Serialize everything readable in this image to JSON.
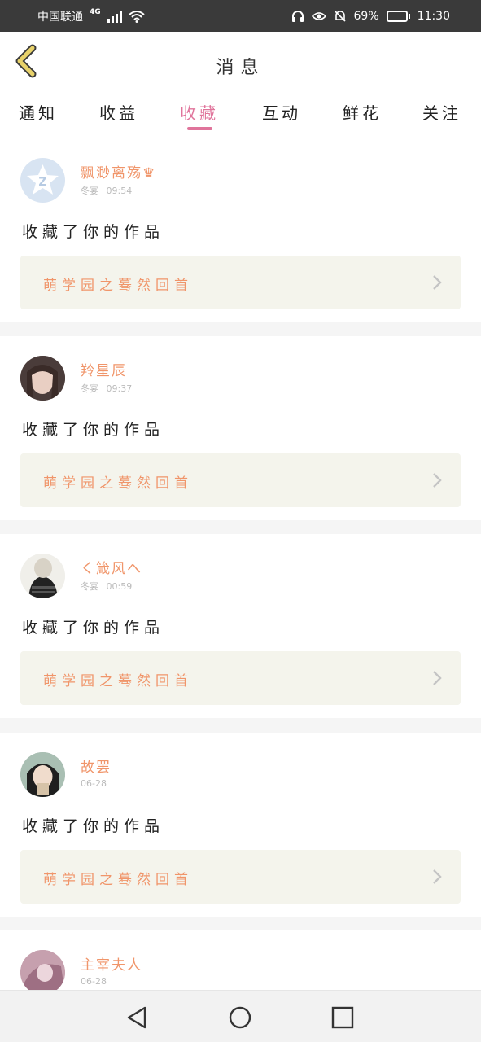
{
  "status_bar": {
    "carrier": "中国联通",
    "network": "4G",
    "battery": "69%",
    "battery_level": 0.69,
    "time": "11:30"
  },
  "header": {
    "title": "消息"
  },
  "tabs": [
    {
      "label": "通知",
      "active": false
    },
    {
      "label": "收益",
      "active": false
    },
    {
      "label": "收藏",
      "active": true
    },
    {
      "label": "互动",
      "active": false
    },
    {
      "label": "鲜花",
      "active": false
    },
    {
      "label": "关注",
      "active": false
    }
  ],
  "messages": [
    {
      "user": "飘渺离殇♛",
      "meta": "冬宴",
      "time": "09:54",
      "action": "收藏了你的作品",
      "work_title": "萌学园之蓦然回首"
    },
    {
      "user": "羚星辰",
      "meta": "冬宴",
      "time": "09:37",
      "action": "收藏了你的作品",
      "work_title": "萌学园之蓦然回首"
    },
    {
      "user": "く箴风へ",
      "meta": "冬宴",
      "time": "00:59",
      "action": "收藏了你的作品",
      "work_title": "萌学园之蓦然回首"
    },
    {
      "user": "故罢",
      "meta": "",
      "time": "06-28",
      "action": "收藏了你的作品",
      "work_title": "萌学园之蓦然回首"
    },
    {
      "user": "主宰夫人",
      "meta": "",
      "time": "06-28",
      "action": "",
      "work_title": ""
    }
  ],
  "colors": {
    "accent": "#e0749b",
    "username": "#f0956a",
    "back_arrow": "#e8d26a"
  }
}
